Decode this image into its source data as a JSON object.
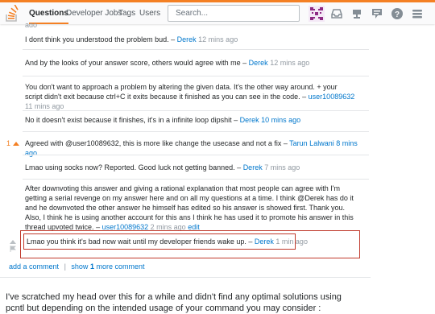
{
  "topbar": {
    "nav": [
      "Questions",
      "Developer Jobs",
      "Tags",
      "Users"
    ],
    "search_placeholder": "Search..."
  },
  "comments": [
    {
      "text": "I dont think you understood the problem bud.",
      "user": "Derek",
      "time": "12 mins ago"
    },
    {
      "text": "And by the looks of your answer score, others would agree with me",
      "user": "Derek",
      "time": "12 mins ago"
    },
    {
      "text": "You don't want to approach a problem by altering the given data. It's the other way around. + your script didn't exit because ctrl+C it exits because it finished as you can see in the code.",
      "user": "user10089632",
      "time": "11 mins ago"
    },
    {
      "text": "No it doesn't exist because it finishes, it's in a infinite loop dipshit",
      "user": "Derek",
      "time": "10 mins ago"
    },
    {
      "text": "Agreed with @user10089632, this is more like change the usecase and not a fix",
      "user": "Tarun Lalwani",
      "time": "8 mins ago",
      "votes": "1"
    },
    {
      "text": "Lmao using socks now? Reported. Good luck not getting banned.",
      "user": "Derek",
      "time": "7 mins ago"
    },
    {
      "text": "After downvoting this answer and giving a rational explanation that most people can agree with I'm getting a serial revenge on my answer here and on all my questions at a time. I think @Derek has do it and he downvoted the other answer he himself has edited so his answer is showed first. Thank you. Also, I think he is using another account for this ans I think he has used it to promote his answer in this thread upvoted twice.",
      "user": "user10089632",
      "time": "2 mins ago",
      "edit": "edit"
    },
    {
      "text": "Lmao you think it's bad now wait until my developer friends wake up.",
      "user": "Derek",
      "time": "1 min ago"
    }
  ],
  "links": {
    "add": "add a comment",
    "show_prefix": "show",
    "show_count": "1",
    "show_suffix": "more comment",
    "sep": "|"
  },
  "answer_text": "I've scratched my head over this for a while and didn't find any optimal solutions using pcntl but depending on the intended usage of your command you may consider :",
  "cut_off_top": "ago"
}
